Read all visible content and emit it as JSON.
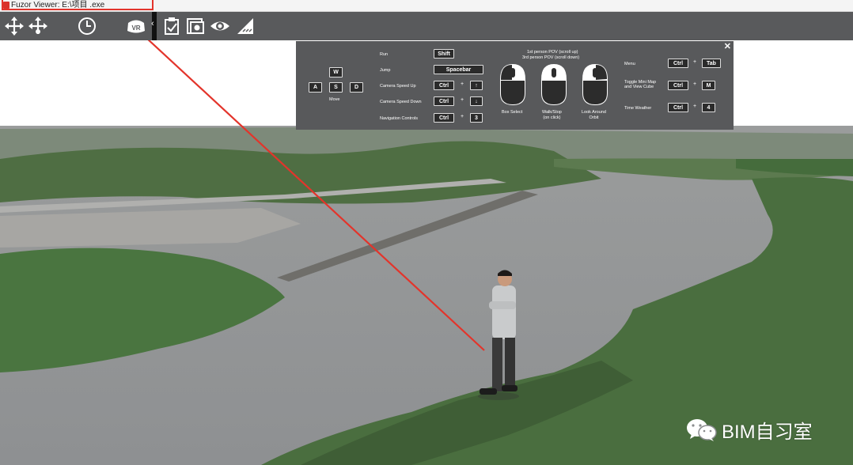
{
  "window": {
    "title": "Fuzor Viewer: E:\\项目       .exe"
  },
  "toolbar": {
    "buttons": [
      {
        "name": "move-icon"
      },
      {
        "name": "fly-icon"
      },
      {
        "name": "clock-icon"
      },
      {
        "name": "vr-headset-icon",
        "label": "VR"
      },
      {
        "name": "clipboard-icon"
      },
      {
        "name": "camera-icon"
      },
      {
        "name": "eye-icon"
      },
      {
        "name": "measure-icon"
      }
    ]
  },
  "controls_panel": {
    "close_label": "✕",
    "move": {
      "keys": [
        "W",
        "A",
        "S",
        "D"
      ],
      "label": "Move"
    },
    "rows": [
      {
        "label": "Run",
        "key": "Shift"
      },
      {
        "label": "Jump",
        "key": "Spacebar"
      },
      {
        "label": "Camera Speed Up",
        "mod": "Ctrl",
        "key": "↑"
      },
      {
        "label": "Camera Speed Down",
        "mod": "Ctrl",
        "key": "↓"
      },
      {
        "label": "Navigation Controls",
        "mod": "Ctrl",
        "key": "3"
      }
    ],
    "pov_line1": "1st person POV (scroll up)",
    "pov_line2": "3rd person POV (scroll down)",
    "mice": [
      {
        "label": "Box Select"
      },
      {
        "label": "Walk/Stop\n(on click)"
      },
      {
        "label": "Look Around\nOrbit"
      }
    ],
    "shortcuts": [
      {
        "label": "Menu",
        "mod": "Ctrl",
        "key": "Tab"
      },
      {
        "label": "Toggle Mini Map\nand View Cube",
        "mod": "Ctrl",
        "key": "M"
      },
      {
        "label": "Time Weather",
        "mod": "Ctrl",
        "key": "4"
      }
    ],
    "plus": "+"
  },
  "watermark": {
    "text": "BIM自习室"
  },
  "colors": {
    "annotation": "#e3342b",
    "toolbar": "#595a5c",
    "panel": "#58595b"
  }
}
